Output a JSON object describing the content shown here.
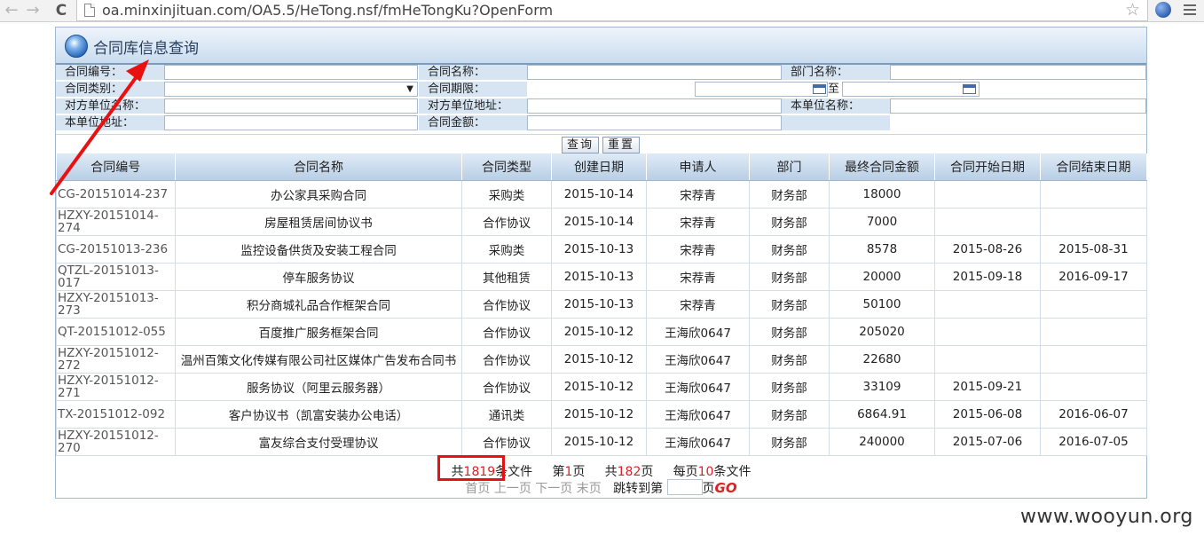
{
  "browser": {
    "url": "oa.minxinjituan.com/OA5.5/HeTong.nsf/fmHeTongKu?OpenForm",
    "back": "←",
    "forward": "→",
    "reload": "C",
    "star": "☆"
  },
  "app": {
    "title": "合同库信息查询",
    "icons": {
      "logo": "globe-logo-icon",
      "calendar": "calendar-icon"
    }
  },
  "form": {
    "contract_no": "合同编号：",
    "contract_name": "合同名称：",
    "dept_name": "部门名称：",
    "contract_type": "合同类别：",
    "contract_period": "合同期限：",
    "to": "至",
    "counterparty_name": "对方单位名称：",
    "counterparty_address": "对方单位地址：",
    "own_unit_name": "本单位名称：",
    "own_unit_address": "本单位地址：",
    "contract_amount": "合同金额：",
    "select_caret": "▼",
    "query_button": "查询",
    "reset_button": "重置"
  },
  "table": {
    "headers": [
      "合同编号",
      "合同名称",
      "合同类型",
      "创建日期",
      "申请人",
      "部门",
      "最终合同金额",
      "合同开始日期",
      "合同结束日期"
    ],
    "rows": [
      [
        "CG-20151014-237",
        "办公家具采购合同",
        "采购类",
        "2015-10-14",
        "宋荐青",
        "财务部",
        "18000",
        "",
        ""
      ],
      [
        "HZXY-20151014-274",
        "房屋租赁居间协议书",
        "合作协议",
        "2015-10-14",
        "宋荐青",
        "财务部",
        "7000",
        "",
        ""
      ],
      [
        "CG-20151013-236",
        "监控设备供货及安装工程合同",
        "采购类",
        "2015-10-13",
        "宋荐青",
        "财务部",
        "8578",
        "2015-08-26",
        "2015-08-31"
      ],
      [
        "QTZL-20151013-017",
        "停车服务协议",
        "其他租赁",
        "2015-10-13",
        "宋荐青",
        "财务部",
        "20000",
        "2015-09-18",
        "2016-09-17"
      ],
      [
        "HZXY-20151013-273",
        "积分商城礼品合作框架合同",
        "合作协议",
        "2015-10-13",
        "宋荐青",
        "财务部",
        "50100",
        "",
        ""
      ],
      [
        "QT-20151012-055",
        "百度推广服务框架合同",
        "合作协议",
        "2015-10-12",
        "王海欣0647",
        "财务部",
        "205020",
        "",
        ""
      ],
      [
        "HZXY-20151012-272",
        "温州百策文化传媒有限公司社区媒体广告发布合同书",
        "合作协议",
        "2015-10-12",
        "王海欣0647",
        "财务部",
        "22680",
        "",
        ""
      ],
      [
        "HZXY-20151012-271",
        "服务协议（阿里云服务器）",
        "合作协议",
        "2015-10-12",
        "王海欣0647",
        "财务部",
        "33109",
        "2015-09-21",
        ""
      ],
      [
        "TX-20151012-092",
        "客户协议书（凯富安装办公电话）",
        "通讯类",
        "2015-10-12",
        "王海欣0647",
        "财务部",
        "6864.91",
        "2015-06-08",
        "2016-06-07"
      ],
      [
        "HZXY-20151012-270",
        "富友综合支付受理协议",
        "合作协议",
        "2015-10-12",
        "王海欣0647",
        "财务部",
        "240000",
        "2015-07-06",
        "2016-07-05"
      ]
    ]
  },
  "pager": {
    "total_prefix": "共",
    "total_count": "1819",
    "total_suffix": "条文件",
    "page_prefix": "第",
    "current_page": "1",
    "page_suffix": "页",
    "pages_prefix": "共",
    "total_pages": "182",
    "pages_suffix": "页",
    "per_page_prefix": "每页",
    "per_page": "10",
    "per_page_suffix": "条文件",
    "first": "首页",
    "prev": "上一页",
    "next": "下一页",
    "last": "末页",
    "jump_prefix": "跳转到第",
    "jump_suffix": "页",
    "go": "GO"
  },
  "annotation": {
    "color": "#e81010"
  },
  "watermark": "www.wooyun.org"
}
